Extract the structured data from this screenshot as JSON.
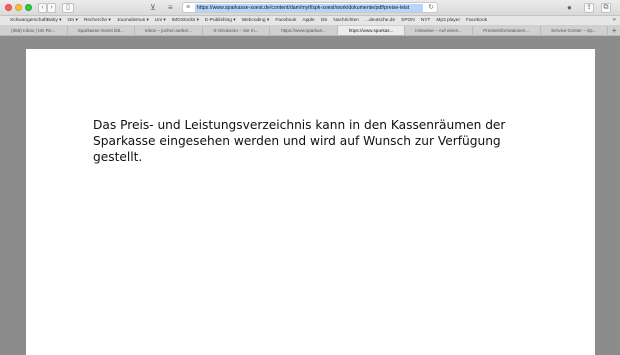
{
  "browser": {
    "url": "https://www.sparkasse-soest.de/content/dam/myif/spk-soest/work/dokumente/pdf/preise-leist",
    "bookmarks": [
      "SchwangerschaftBaby ▾",
      "t3n ▾",
      "Recherche ▾",
      "Journalismus ▾",
      "Uni ▾",
      "IMGStocks ▾",
      "E-Publishing ▾",
      "Webcoding ▾",
      "Facebook",
      "Apple",
      "t3n",
      "Nachrichten",
      "...deutsche.de",
      "SPON",
      "NYT",
      "Mp3 player",
      "Facebook"
    ],
    "tabs": [
      {
        "label": "(368) Inbox | t3n Re..."
      },
      {
        "label": "Sparkasse-Soest bitt..."
      },
      {
        "label": "Inbox – jochen.weber..."
      },
      {
        "label": "S-Girokonto – Sie m..."
      },
      {
        "label": "https://www.sparkas..."
      },
      {
        "label": "https://www.sparkas..."
      },
      {
        "label": "Hinweise – Auf einen..."
      },
      {
        "label": "Presseinformationen..."
      },
      {
        "label": "Service-Center – Sp..."
      }
    ],
    "active_tab_index": 5
  },
  "document": {
    "text": "Das Preis- und Leistungsverzeichnis kann in den Kassenräumen der Sparkasse eingesehen werden und wird auf Wunsch zur Verfügung gestellt."
  }
}
